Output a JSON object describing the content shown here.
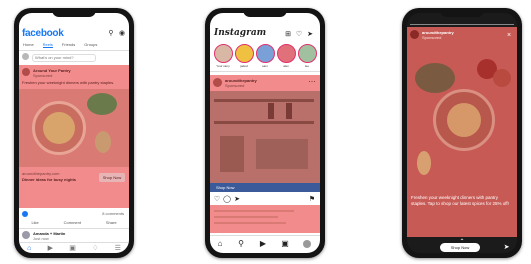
{
  "facebook": {
    "logo": "facebook",
    "tabs": [
      "Home",
      "Reels",
      "Friends",
      "Groups"
    ],
    "status_prompt": "What's on your mind?",
    "ad": {
      "page_name": "Around Your Pantry",
      "sponsored": "Sponsored",
      "caption": "Freshen your weeknight dinners with pantry staples.",
      "cta_domain": "aroundthepantry.com",
      "cta_headline": "Dinner ideas for busy nights",
      "cta_button": "Shop Now"
    },
    "reactions": "8 comments",
    "actions": [
      "Like",
      "Comment",
      "Share"
    ],
    "next_post_name": "Amanda + Martin",
    "next_post_sub": "Just now"
  },
  "instagram": {
    "logo": "Instagram",
    "stories": [
      "Your story",
      "jaded",
      "sam",
      "alex",
      "lee"
    ],
    "post_account": "aroundthepantry",
    "post_sponsored": "Sponsored",
    "cta": "Shop Now"
  },
  "story": {
    "account": "aroundthepantry",
    "sponsored": "Sponsored",
    "text": "Freshen your weeknight dinners with pantry staples. Tap to shop our latest spices for 25% off!",
    "button": "Shop Now"
  },
  "colors": {
    "fb_blue": "#1877f2",
    "ad_pink": "#f28c8c",
    "instagram_cta": "#3a5a9a",
    "story_bg": "#c85a55"
  }
}
